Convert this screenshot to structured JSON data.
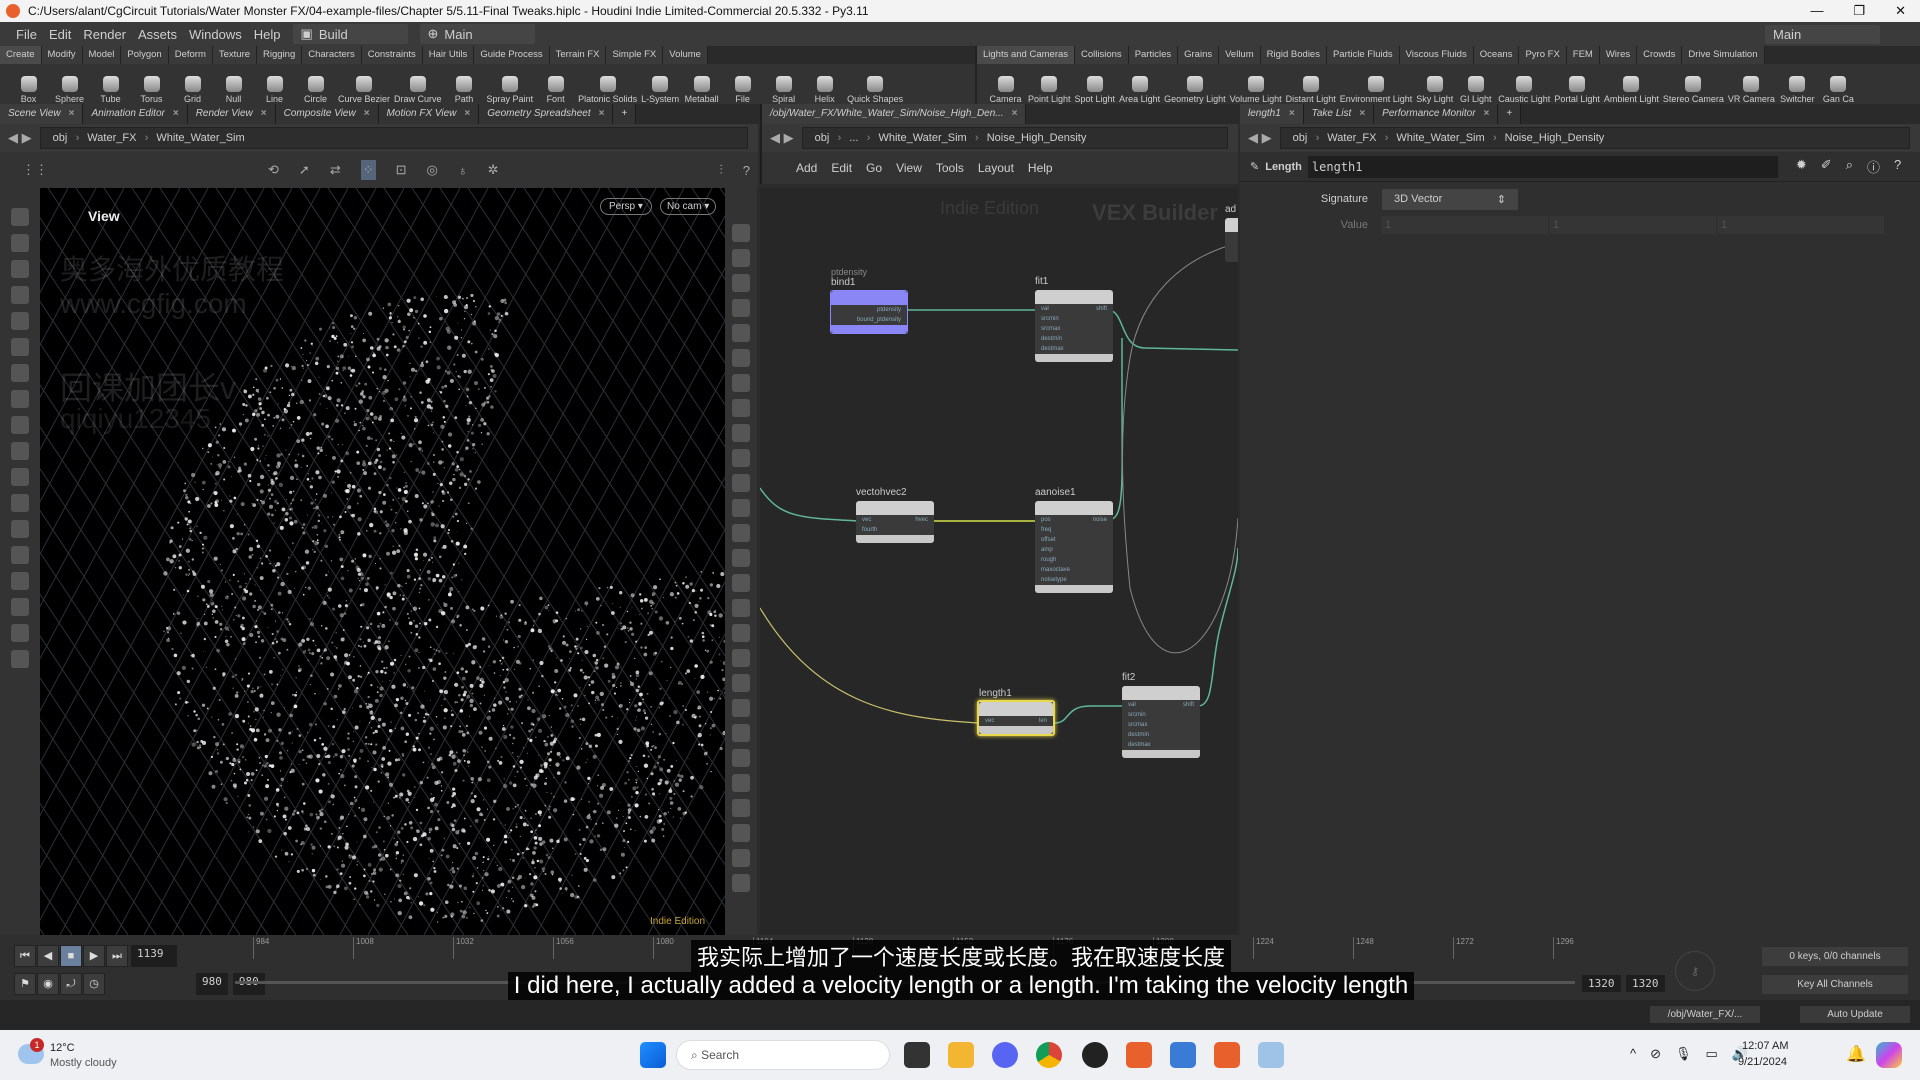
{
  "window": {
    "title": "C:/Users/alant/CgCircuit Tutorials/Water Monster FX/04-example-files/Chapter 5/5.11-Final Tweaks.hiplc - Houdini Indie Limited-Commercial 20.5.332 - Py3.11",
    "controls": [
      "—",
      "❐",
      "✕"
    ]
  },
  "menu": {
    "items": [
      "File",
      "Edit",
      "Render",
      "Assets",
      "Windows",
      "Help"
    ],
    "desktop": "Build",
    "runtime": "Main",
    "right_desktop": "Main"
  },
  "shelf_left": {
    "tabs": [
      "Create",
      "Modify",
      "Model",
      "Polygon",
      "Deform",
      "Texture",
      "Rigging",
      "Characters",
      "Constraints",
      "Hair Utils",
      "Guide Process",
      "Terrain FX",
      "Simple FX",
      "Volume"
    ],
    "tools": [
      "Box",
      "Sphere",
      "Tube",
      "Torus",
      "Grid",
      "Null",
      "Line",
      "Circle",
      "Curve Bezier",
      "Draw Curve",
      "Path",
      "Spray Paint",
      "Font",
      "Platonic Solids",
      "L-System",
      "Metaball",
      "File",
      "Spiral",
      "Helix",
      "Quick Shapes"
    ]
  },
  "shelf_right": {
    "tabs": [
      "Lights and Cameras",
      "Collisions",
      "Particles",
      "Grains",
      "Vellum",
      "Rigid Bodies",
      "Particle Fluids",
      "Viscous Fluids",
      "Oceans",
      "Pyro FX",
      "FEM",
      "Wires",
      "Crowds",
      "Drive Simulation"
    ],
    "tools": [
      "Camera",
      "Point Light",
      "Spot Light",
      "Area Light",
      "Geometry Light",
      "Volume Light",
      "Distant Light",
      "Environment Light",
      "Sky Light",
      "GI Light",
      "Caustic Light",
      "Portal Light",
      "Ambient Light",
      "Stereo Camera",
      "VR Camera",
      "Switcher",
      "Gan Ca"
    ]
  },
  "scene_pane": {
    "tabs": [
      "Scene View",
      "Animation Editor",
      "Render View",
      "Composite View",
      "Motion FX View",
      "Geometry Spreadsheet"
    ],
    "path": [
      "obj",
      "Water_FX",
      "White_Water_Sim"
    ],
    "view_label": "View",
    "persp": "Persp ▾",
    "cam": "No cam ▾",
    "watermark": "Indie Edition",
    "overlay_cn": "奥多海外优质教程",
    "overlay_url": "www.cgfig.com",
    "overlay_cn2": "回课加团长v",
    "overlay_id": "qiqiyu12345"
  },
  "network_pane": {
    "tab": "/obj/Water_FX/White_Water_Sim/Noise_High_Den...",
    "path": [
      "obj",
      "...",
      "White_Water_Sim",
      "Noise_High_Density"
    ],
    "menu": [
      "Add",
      "Edit",
      "Go",
      "View",
      "Tools",
      "Layout",
      "Help"
    ],
    "watermark": "Indie Edition",
    "context": "VEX Builder",
    "nodes": {
      "bind1": {
        "name": "bind1",
        "sub": "ptdensity",
        "pins": [
          "ptdensity",
          "bound_ptdensity"
        ]
      },
      "fit1": {
        "name": "fit1",
        "pins": [
          "val",
          "srcmin",
          "srcmax",
          "destmin",
          "destmax"
        ],
        "out": "shift"
      },
      "vectohvec2": {
        "name": "vectohvec2",
        "pins": [
          "vec",
          "fourth"
        ],
        "out": "hvec"
      },
      "aanoise1": {
        "name": "aanoise1",
        "pins": [
          "pos",
          "freq",
          "offset",
          "amp",
          "rough",
          "maxoctave",
          "noisetype"
        ],
        "out": "noise"
      },
      "length1": {
        "name": "length1",
        "pins": [
          "vec"
        ],
        "out": "len"
      },
      "fit2": {
        "name": "fit2",
        "pins": [
          "val",
          "srcmin",
          "srcmax",
          "destmin",
          "destmax"
        ],
        "out": "shift"
      },
      "add": {
        "name": "ad"
      }
    }
  },
  "param_pane": {
    "tabs": [
      "length1",
      "Take List",
      "Performance Monitor"
    ],
    "path": [
      "obj",
      "Water_FX",
      "White_Water_Sim",
      "Noise_High_Density"
    ],
    "node_type": "Length",
    "node_name": "length1",
    "signature_label": "Signature",
    "signature": "3D Vector",
    "value_label": "Value",
    "values": [
      "1",
      "1",
      "1"
    ]
  },
  "timeline": {
    "frame": "1139",
    "start": "980",
    "start2": "980",
    "end": "1320",
    "end2": "1320",
    "ticks": [
      "984",
      "1008",
      "1032",
      "1056",
      "1080",
      "1104",
      "1128",
      "1152",
      "1176",
      "1200",
      "1224",
      "1248",
      "1272",
      "1296"
    ],
    "keys": "0 keys, 0/0 channels",
    "key_all": "Key All Channels",
    "obj_path": "/obj/Water_FX/...",
    "update": "Auto Update"
  },
  "subtitles": {
    "cn": "我实际上增加了一个速度长度或长度。我在取速度长度",
    "en": "I did here, I actually added a velocity length or a length. I'm taking the velocity length"
  },
  "taskbar": {
    "temp": "12°C",
    "weather": "Mostly cloudy",
    "weather_badge": "1",
    "search": "Search",
    "time": "12:07 AM",
    "date": "9/21/2024"
  }
}
